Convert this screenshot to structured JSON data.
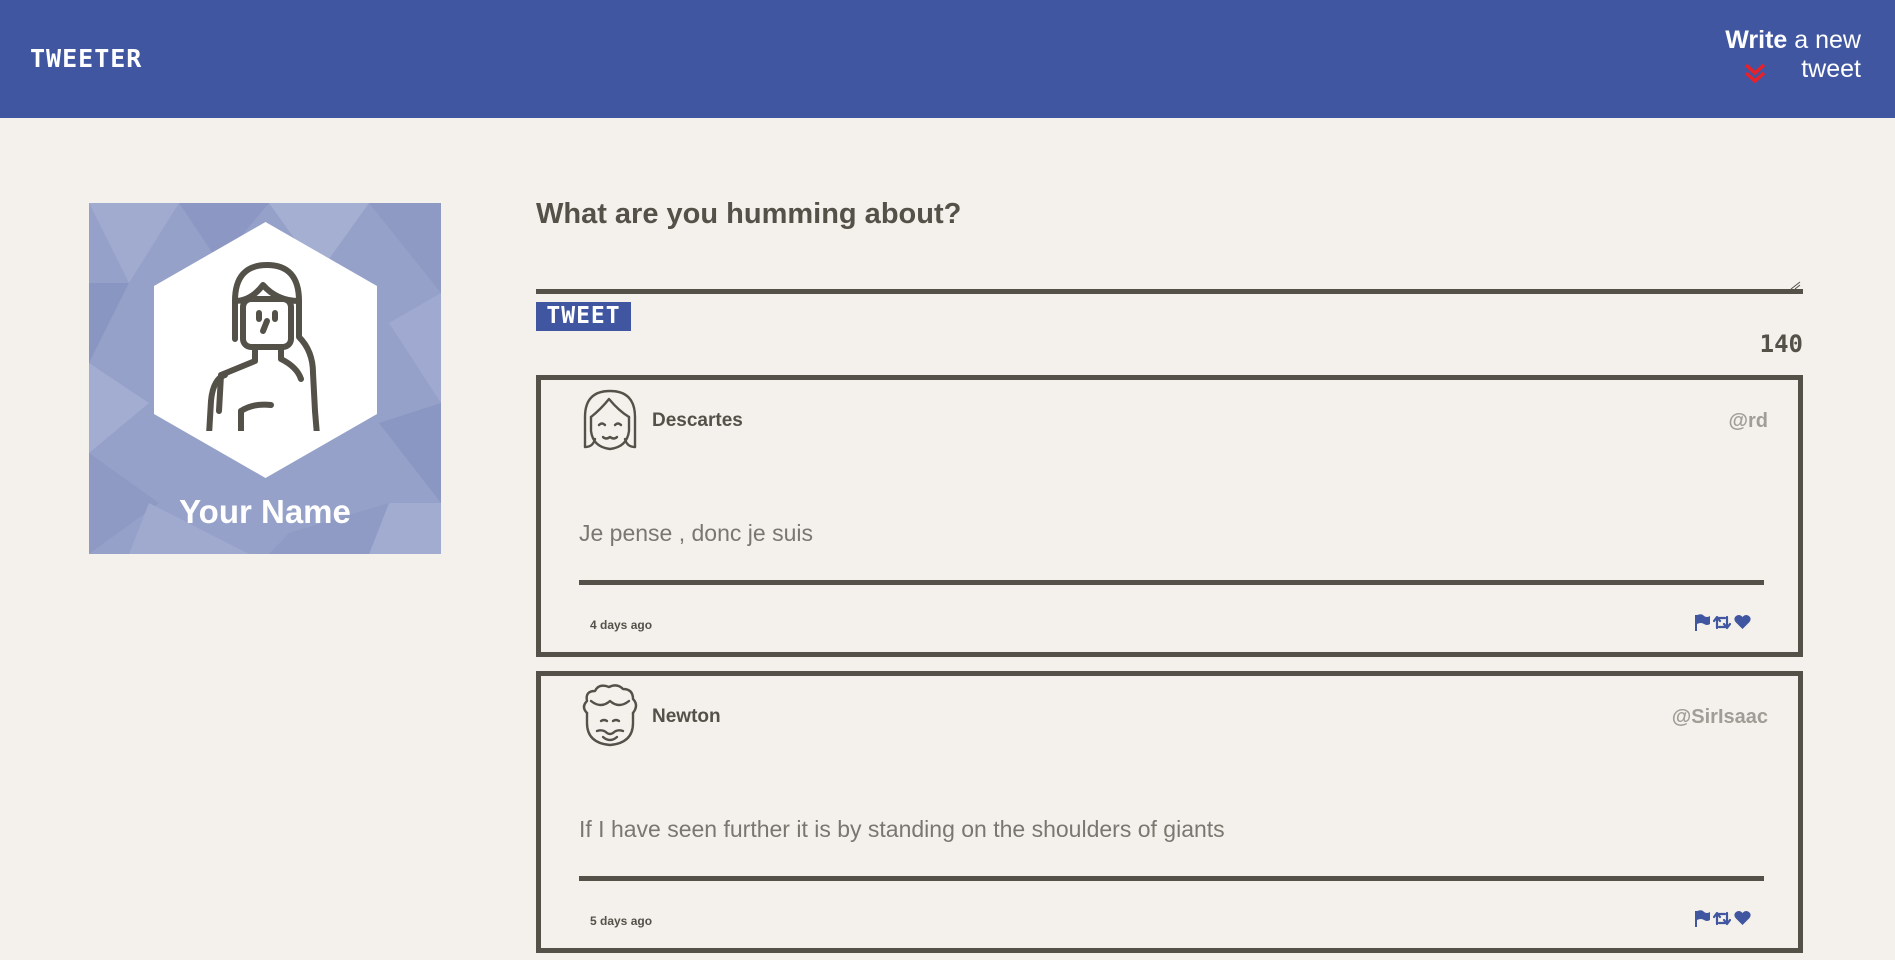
{
  "nav": {
    "logo": "TWEETER",
    "compose_strong": "Write",
    "compose_rest": " a new tweet",
    "chevron_icon": "double-chevron-down-icon",
    "chevron_color": "#e8202a"
  },
  "profile": {
    "name": "Your Name",
    "background_color": "#95a1c9"
  },
  "compose": {
    "title": "What are you humming about?",
    "input_value": "",
    "button_label": "TWEET",
    "counter": "140"
  },
  "tweets": [
    {
      "name": "Descartes",
      "handle": "@rd",
      "content": "Je pense , donc je suis",
      "time": "4 days ago",
      "avatar_icon": "girl-bangs-avatar-icon",
      "actions": [
        "flag-icon",
        "retweet-icon",
        "heart-icon"
      ]
    },
    {
      "name": "Newton",
      "handle": "@SirIsaac",
      "content": "If I have seen further it is by standing on the shoulders of giants",
      "time": "5 days ago",
      "avatar_icon": "curly-hair-avatar-icon",
      "actions": [
        "flag-icon",
        "retweet-icon",
        "heart-icon"
      ]
    }
  ],
  "colors": {
    "brand": "#4056a1",
    "background": "#f4f1ec",
    "text": "#545149",
    "muted": "#a09d96",
    "accent": "#e8202a"
  }
}
